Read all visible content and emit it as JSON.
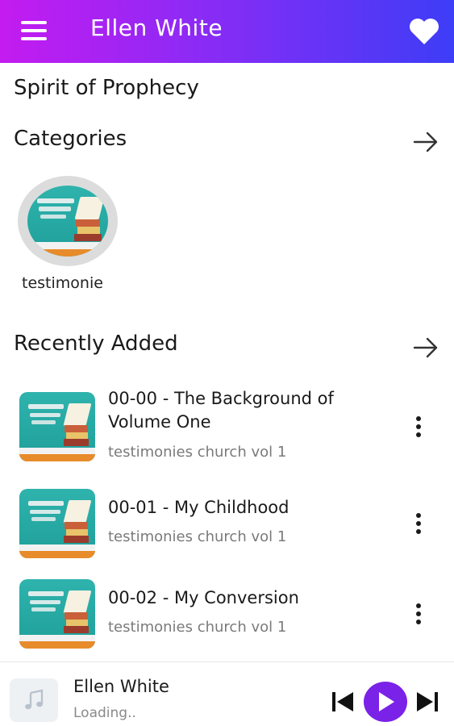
{
  "appbar": {
    "title": "Ellen White",
    "menu_icon": "hamburger-menu-icon",
    "favorite_icon": "heart-icon"
  },
  "section_title": "Spirit of Prophecy",
  "categories": {
    "heading": "Categories",
    "arrow_icon": "arrow-right-icon",
    "items": [
      {
        "label": "testimonie"
      }
    ]
  },
  "recent": {
    "heading": "Recently Added",
    "arrow_icon": "arrow-right-icon",
    "items": [
      {
        "title": "00-00 - The Background of Volume One",
        "subtitle": "testimonies church vol 1"
      },
      {
        "title": "00-01 - My Childhood",
        "subtitle": "testimonies church vol 1"
      },
      {
        "title": "00-02 - My Conversion",
        "subtitle": "testimonies church vol 1"
      }
    ]
  },
  "player": {
    "title": "Ellen White",
    "status": "Loading..",
    "art_icon": "music-note-icon",
    "accent": "#7a22e8"
  },
  "colors": {
    "gradient_start": "#c41bf0",
    "gradient_end": "#3d3df7",
    "cover_teal": "#2fb3ad"
  }
}
